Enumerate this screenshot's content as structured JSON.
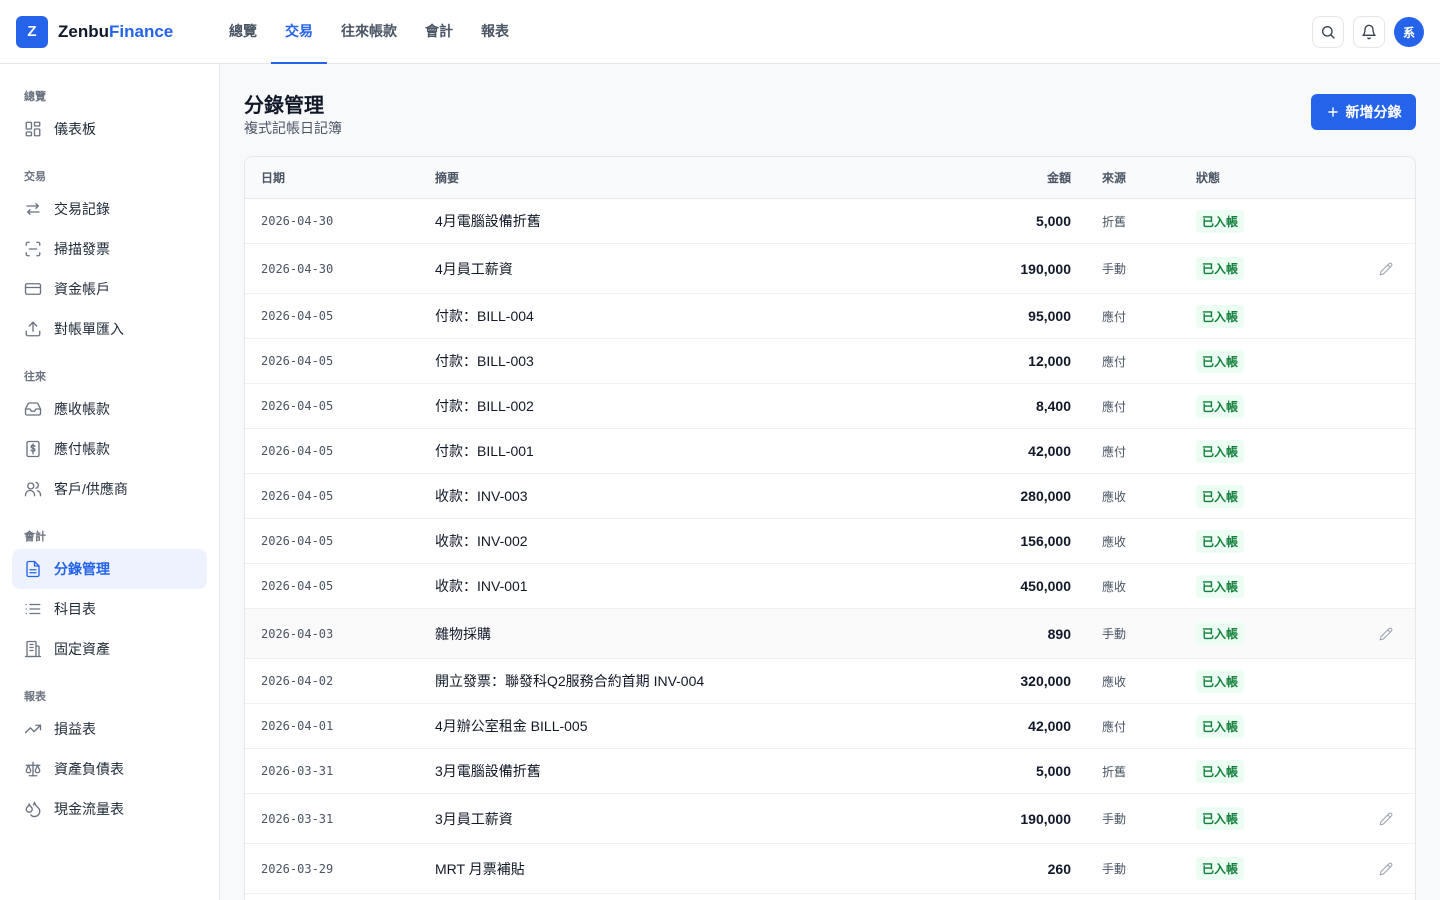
{
  "brand": {
    "logo_letter": "Z",
    "name_main": "Zenbu",
    "name_accent": "Finance"
  },
  "topnav": [
    {
      "label": "總覽",
      "active": false
    },
    {
      "label": "交易",
      "active": true
    },
    {
      "label": "往來帳款",
      "active": false
    },
    {
      "label": "會計",
      "active": false
    },
    {
      "label": "報表",
      "active": false
    }
  ],
  "user": {
    "avatar_text": "系"
  },
  "sidebar": {
    "sections": [
      {
        "title": "總覽",
        "items": [
          {
            "label": "儀表板",
            "icon": "dashboard-icon"
          }
        ]
      },
      {
        "title": "交易",
        "items": [
          {
            "label": "交易記錄",
            "icon": "transfer-icon"
          },
          {
            "label": "掃描發票",
            "icon": "scan-icon"
          },
          {
            "label": "資金帳戶",
            "icon": "credit-card-icon"
          },
          {
            "label": "對帳單匯入",
            "icon": "upload-icon"
          }
        ]
      },
      {
        "title": "往來",
        "items": [
          {
            "label": "應收帳款",
            "icon": "inbox-icon"
          },
          {
            "label": "應付帳款",
            "icon": "dollar-file-icon"
          },
          {
            "label": "客戶/供應商",
            "icon": "users-icon"
          }
        ]
      },
      {
        "title": "會計",
        "items": [
          {
            "label": "分錄管理",
            "icon": "document-icon",
            "active": true
          },
          {
            "label": "科目表",
            "icon": "list-icon"
          },
          {
            "label": "固定資產",
            "icon": "building-icon"
          }
        ]
      },
      {
        "title": "報表",
        "items": [
          {
            "label": "損益表",
            "icon": "trending-up-icon"
          },
          {
            "label": "資產負債表",
            "icon": "scale-icon"
          },
          {
            "label": "現金流量表",
            "icon": "droplets-icon"
          }
        ]
      }
    ]
  },
  "page": {
    "title": "分錄管理",
    "subtitle": "複式記帳日記簿",
    "add_button": "新增分錄"
  },
  "table": {
    "headers": {
      "date": "日期",
      "desc": "摘要",
      "amount": "金額",
      "source": "來源",
      "status": "狀態"
    },
    "rows": [
      {
        "date": "2026-04-30",
        "desc": "4月電腦設備折舊",
        "amount": "5,000",
        "source": "折舊",
        "status": "已入帳",
        "editable": false
      },
      {
        "date": "2026-04-30",
        "desc": "4月員工薪資",
        "amount": "190,000",
        "source": "手動",
        "status": "已入帳",
        "editable": true
      },
      {
        "date": "2026-04-05",
        "desc": "付款：BILL-004",
        "amount": "95,000",
        "source": "應付",
        "status": "已入帳",
        "editable": false
      },
      {
        "date": "2026-04-05",
        "desc": "付款：BILL-003",
        "amount": "12,000",
        "source": "應付",
        "status": "已入帳",
        "editable": false
      },
      {
        "date": "2026-04-05",
        "desc": "付款：BILL-002",
        "amount": "8,400",
        "source": "應付",
        "status": "已入帳",
        "editable": false
      },
      {
        "date": "2026-04-05",
        "desc": "付款：BILL-001",
        "amount": "42,000",
        "source": "應付",
        "status": "已入帳",
        "editable": false
      },
      {
        "date": "2026-04-05",
        "desc": "收款：INV-003",
        "amount": "280,000",
        "source": "應收",
        "status": "已入帳",
        "editable": false
      },
      {
        "date": "2026-04-05",
        "desc": "收款：INV-002",
        "amount": "156,000",
        "source": "應收",
        "status": "已入帳",
        "editable": false
      },
      {
        "date": "2026-04-05",
        "desc": "收款：INV-001",
        "amount": "450,000",
        "source": "應收",
        "status": "已入帳",
        "editable": false
      },
      {
        "date": "2026-04-03",
        "desc": "雜物採購",
        "amount": "890",
        "source": "手動",
        "status": "已入帳",
        "editable": true,
        "hover": true
      },
      {
        "date": "2026-04-02",
        "desc": "開立發票：聯發科Q2服務合約首期 INV-004",
        "amount": "320,000",
        "source": "應收",
        "status": "已入帳",
        "editable": false
      },
      {
        "date": "2026-04-01",
        "desc": "4月辦公室租金 BILL-005",
        "amount": "42,000",
        "source": "應付",
        "status": "已入帳",
        "editable": false
      },
      {
        "date": "2026-03-31",
        "desc": "3月電腦設備折舊",
        "amount": "5,000",
        "source": "折舊",
        "status": "已入帳",
        "editable": false
      },
      {
        "date": "2026-03-31",
        "desc": "3月員工薪資",
        "amount": "190,000",
        "source": "手動",
        "status": "已入帳",
        "editable": true
      },
      {
        "date": "2026-03-29",
        "desc": "MRT 月票補貼",
        "amount": "260",
        "source": "手動",
        "status": "已入帳",
        "editable": true
      }
    ]
  }
}
